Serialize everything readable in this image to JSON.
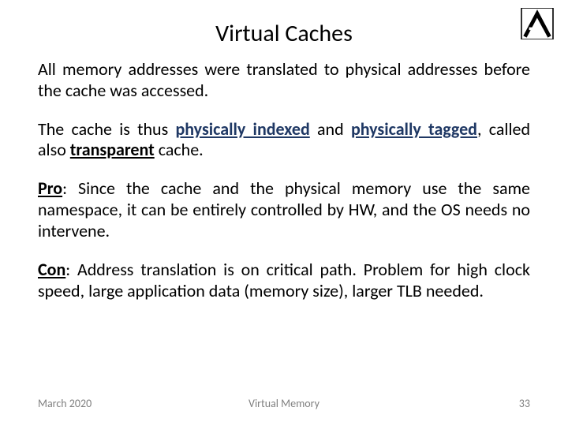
{
  "title": "Virtual Caches",
  "p1": {
    "t1": "All memory addresses were translated to physical addresses before the cache was accessed."
  },
  "p2": {
    "t1": "The cache is thus ",
    "b1": "physically indexed",
    "t2": " and ",
    "b2": "physically tagged",
    "t3": ", called also ",
    "b3": "transparent",
    "t4": " cache."
  },
  "p3": {
    "label": "Pro",
    "t1": ": Since the cache and the physical memory use the same namespace, it can be entirely controlled by HW, and the OS needs no intervene."
  },
  "p4": {
    "label": "Con",
    "t1": ": Address translation is on critical path. Problem for high clock speed, large application data (memory size), larger TLB needed."
  },
  "footer": {
    "date": "March 2020",
    "topic": "Virtual Memory",
    "page": "33"
  }
}
